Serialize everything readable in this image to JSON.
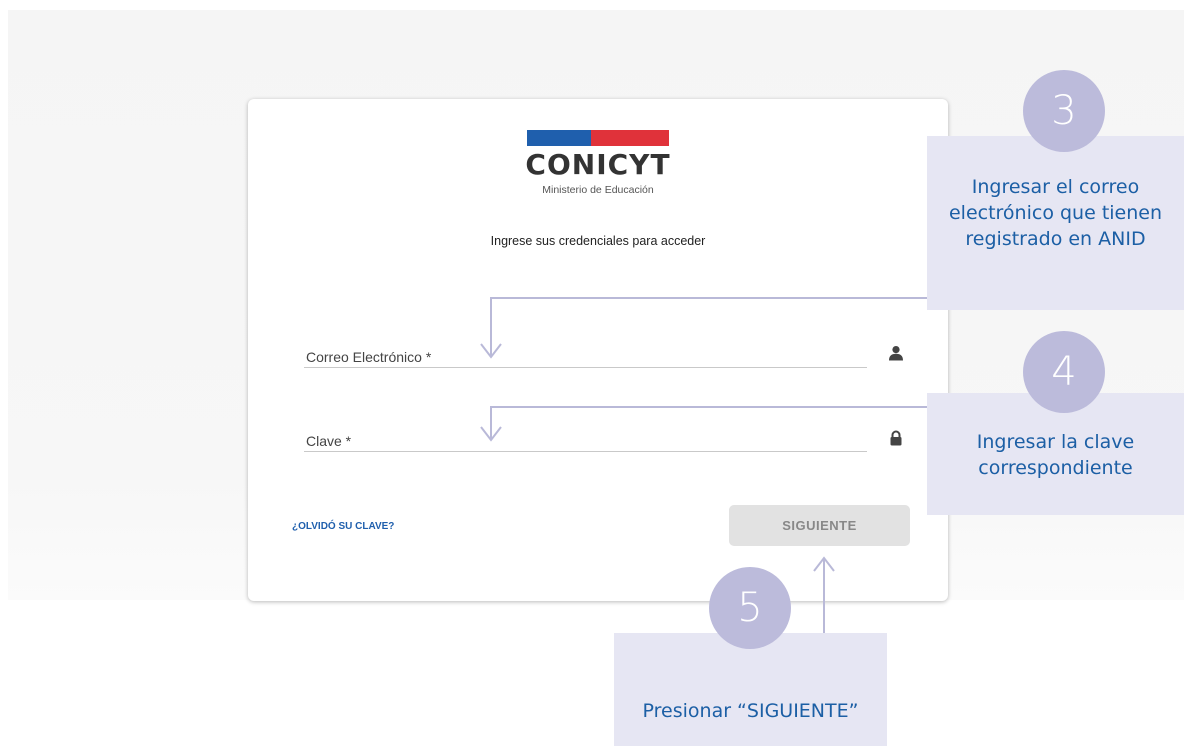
{
  "logo": {
    "brand": "CONICYT",
    "ministry": "Ministerio de Educación",
    "flag_colors": [
      "#1f5fad",
      "#e0323a"
    ]
  },
  "login": {
    "intro": "Ingrese sus credenciales para acceder",
    "email_label": "Correo Electrónico *",
    "email_value": "",
    "email_icon": "user-icon",
    "password_label": "Clave *",
    "password_value": "",
    "password_icon": "lock-icon",
    "forgot_link": "¿OLVIDÓ SU CLAVE?",
    "next_button": "SIGUIENTE"
  },
  "callouts": [
    {
      "number": "3",
      "text": "Ingresar el correo electrónico que tienen registrado en ANID"
    },
    {
      "number": "4",
      "text": "Ingresar la clave correspondiente"
    },
    {
      "number": "5",
      "text": "Presionar “SIGUIENTE”"
    }
  ],
  "colors": {
    "link": "#1f5fad",
    "callout_bg": "#e6e6f3",
    "callout_text": "#1c5fa5",
    "badge": "#bcbbdb",
    "button_bg": "#e2e2e2"
  }
}
